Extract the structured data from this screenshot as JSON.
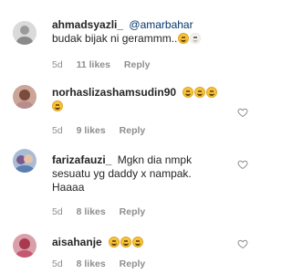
{
  "comments": [
    {
      "username": "ahmadsyazli_",
      "mention": "@amarbahar",
      "text": "budak bijak ni gerammm..",
      "emoji_count": 2,
      "age": "5d",
      "likes": "11 likes",
      "reply": "Reply",
      "avatar_color": "#cfcfcf"
    },
    {
      "username": "norhaslizashamsudin90",
      "text": "",
      "emoji_count": 4,
      "age": "5d",
      "likes": "9 likes",
      "reply": "Reply",
      "avatar_color": "#c79a8a"
    },
    {
      "username": "farizafauzi_",
      "text_line1": "Mgkn dia nmpk",
      "text_line2": "sesuatu yg daddy x nampak.",
      "text_line3": "Haaaa",
      "age": "5d",
      "likes": "8 likes",
      "reply": "Reply",
      "avatar_color": "#8fa8c8"
    },
    {
      "username": "aisahanje",
      "text": "",
      "emoji_count": 3,
      "age": "5d",
      "likes": "8 likes",
      "reply": "Reply",
      "avatar_color": "#b34a5a"
    }
  ],
  "colors": {
    "text": "#262626",
    "meta": "#8e8e8e",
    "mention": "#00376b"
  },
  "icons": {
    "like": "heart-outline-icon",
    "emoji": "laughing-emoji-icon"
  }
}
